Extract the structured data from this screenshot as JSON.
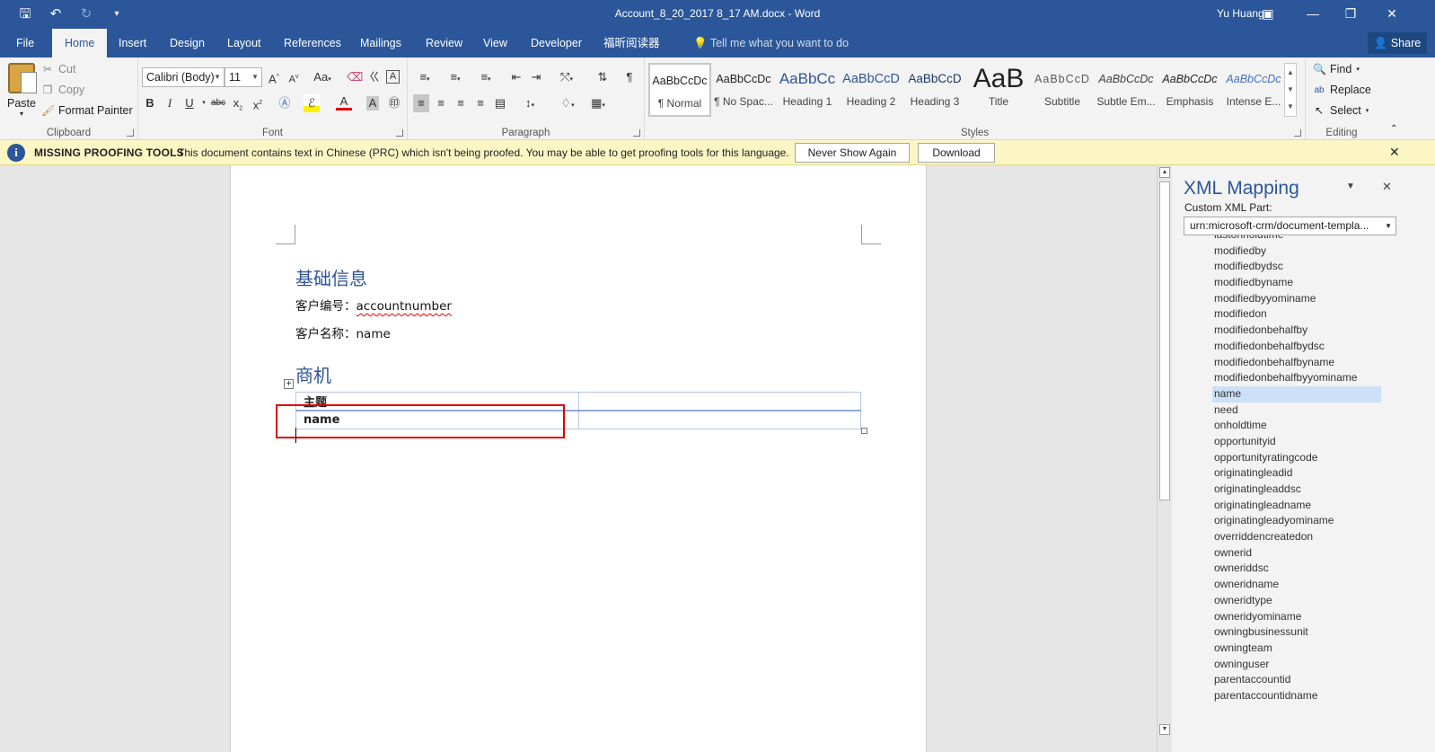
{
  "titlebar": {
    "doc_title": "Account_8_20_2017 8_17 AM.docx  -  Word",
    "user": "Yu Huang",
    "icons": [
      "save-icon",
      "undo-icon",
      "redo-icon",
      "customize-qat-icon",
      "ribbon-display-icon",
      "minimize-icon",
      "restore-icon",
      "close-icon"
    ]
  },
  "tabs": [
    "File",
    "Home",
    "Insert",
    "Design",
    "Layout",
    "References",
    "Mailings",
    "Review",
    "View",
    "Developer",
    "福昕阅读器"
  ],
  "active_tab": "Home",
  "tell_me": "Tell me what you want to do",
  "share": "Share",
  "clipboard": {
    "paste": "Paste",
    "cut": "Cut",
    "copy": "Copy",
    "format_painter": "Format Painter",
    "label": "Clipboard"
  },
  "font": {
    "name": "Calibri (Body)",
    "size": "11",
    "label": "Font",
    "change_case": "Aa"
  },
  "paragraph": {
    "label": "Paragraph"
  },
  "styles": {
    "label": "Styles",
    "items": [
      {
        "sample": "AaBbCcDc",
        "name": "¶ Normal"
      },
      {
        "sample": "AaBbCcDc",
        "name": "¶ No Spac..."
      },
      {
        "sample": "AaBbCc",
        "name": "Heading 1"
      },
      {
        "sample": "AaBbCcD",
        "name": "Heading 2"
      },
      {
        "sample": "AaBbCcD",
        "name": "Heading 3"
      },
      {
        "sample": "AaB",
        "name": "Title"
      },
      {
        "sample": "AaBbCcD",
        "name": "Subtitle"
      },
      {
        "sample": "AaBbCcDc",
        "name": "Subtle Em..."
      },
      {
        "sample": "AaBbCcDc",
        "name": "Emphasis"
      },
      {
        "sample": "AaBbCcDc",
        "name": "Intense E..."
      }
    ]
  },
  "editing": {
    "find": "Find",
    "replace": "Replace",
    "select": "Select",
    "label": "Editing"
  },
  "infobar": {
    "title": "MISSING PROOFING TOOLS",
    "message": "This document contains text in Chinese (PRC) which isn't being proofed. You may be able to get proofing tools for this language.",
    "never_show": "Never Show Again",
    "download": "Download"
  },
  "document": {
    "heading1": "基础信息",
    "line1_label": "客户编号：",
    "line1_value": "accountnumber",
    "line2_label": "客户名称：",
    "line2_value": "name",
    "heading2": "商机",
    "table": [
      [
        "主题",
        ""
      ],
      [
        "name",
        ""
      ]
    ]
  },
  "xml_pane": {
    "title": "XML Mapping",
    "custom_part_label": "Custom XML Part:",
    "custom_part_value": "urn:microsoft-crm/document-templa...",
    "selected": "name",
    "items": [
      "lastonholdtime",
      "modifiedby",
      "modifiedbydsc",
      "modifiedbyname",
      "modifiedbyyominame",
      "modifiedon",
      "modifiedonbehalfby",
      "modifiedonbehalfbydsc",
      "modifiedonbehalfbyname",
      "modifiedonbehalfbyyominame",
      "name",
      "need",
      "onholdtime",
      "opportunityid",
      "opportunityratingcode",
      "originatingleadid",
      "originatingleaddsc",
      "originatingleadname",
      "originatingleadyominame",
      "overriddencreatedon",
      "ownerid",
      "owneriddsc",
      "owneridname",
      "owneridtype",
      "owneridyominame",
      "owningbusinessunit",
      "owningteam",
      "owninguser",
      "parentaccountid",
      "parentaccountidname"
    ]
  }
}
